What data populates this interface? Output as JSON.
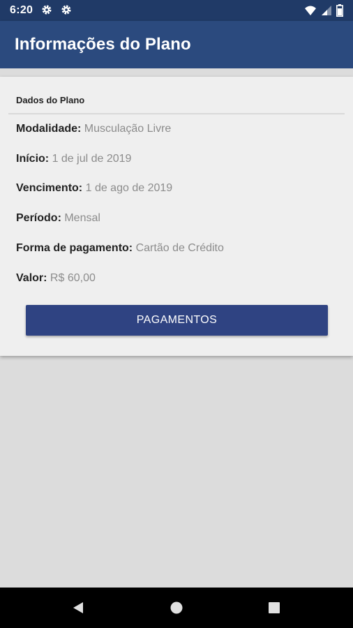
{
  "status_bar": {
    "time": "6:20",
    "icons": [
      "gear-icon",
      "gear-icon",
      "wifi-icon",
      "signal-icon",
      "battery-icon"
    ]
  },
  "app_bar": {
    "title": "Informações do Plano",
    "color": "#2b4a7e"
  },
  "card": {
    "header": "Dados do Plano",
    "rows": [
      {
        "label": "Modalidade:",
        "value": "Musculação Livre"
      },
      {
        "label": "Início:",
        "value": "1 de jul de 2019"
      },
      {
        "label": "Vencimento:",
        "value": "1 de ago de 2019"
      },
      {
        "label": "Período:",
        "value": "Mensal"
      },
      {
        "label": "Forma de pagamento:",
        "value": "Cartão de Crédito"
      },
      {
        "label": "Valor:",
        "value": "R$ 60,00"
      }
    ],
    "button_label": "PAGAMENTOS",
    "button_color": "#2f4382"
  },
  "nav_bar": {
    "icons": [
      "back-icon",
      "home-icon",
      "recents-icon"
    ]
  }
}
